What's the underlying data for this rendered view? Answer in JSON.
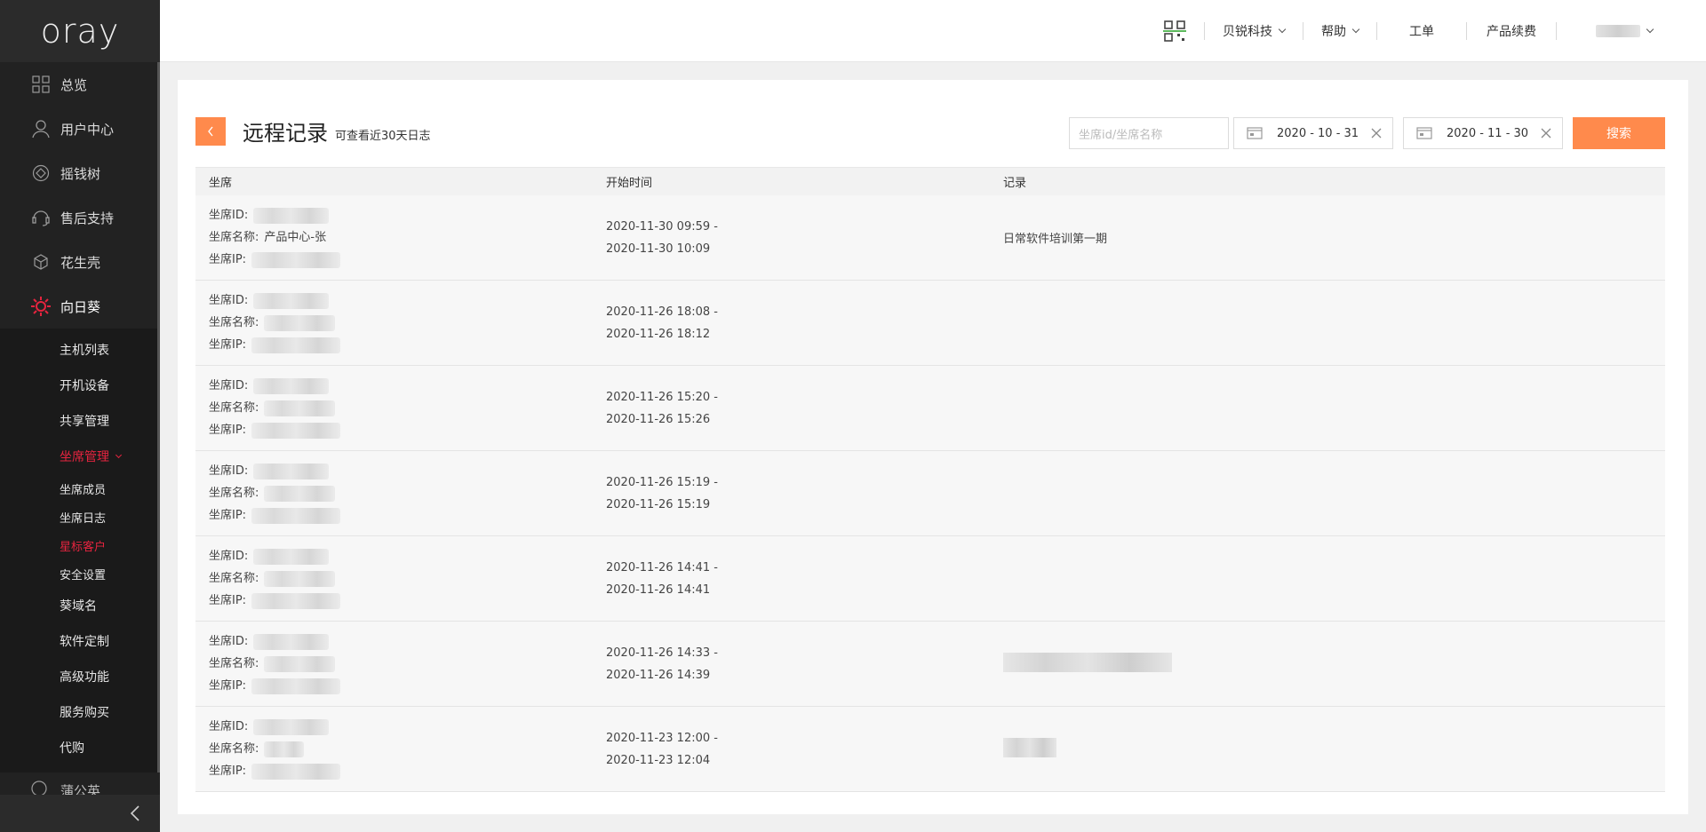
{
  "brand": {
    "logo": "oray"
  },
  "sidebar": {
    "items": [
      {
        "label": "总览",
        "icon": "grid-icon"
      },
      {
        "label": "用户中心",
        "icon": "user-icon"
      },
      {
        "label": "摇钱树",
        "icon": "diamond-icon"
      },
      {
        "label": "售后支持",
        "icon": "headset-icon"
      },
      {
        "label": "花生壳",
        "icon": "shell-icon"
      },
      {
        "label": "向日葵",
        "icon": "sunflower-icon"
      }
    ],
    "sub_items": [
      "主机列表",
      "开机设备",
      "共享管理",
      "坐席管理"
    ],
    "seat_sub_items": [
      "坐席成员",
      "坐席日志",
      "星标客户",
      "安全设置"
    ],
    "more_items": [
      "葵域名",
      "软件定制",
      "高级功能",
      "服务购买",
      "代购"
    ],
    "peek_item": "蒲公英",
    "active_color": "#e6243f"
  },
  "header": {
    "org": "贝锐科技",
    "help": "帮助",
    "ticket": "工单",
    "renew": "产品续费"
  },
  "page": {
    "title": "远程记录",
    "subtitle": "可查看近30天日志",
    "search_placeholder": "坐席id/坐席名称",
    "date_from": "2020 - 10 - 31",
    "date_to": "2020 - 11 - 30",
    "search_button": "搜索",
    "accent": "#ff8a4c"
  },
  "table": {
    "headers": [
      "坐席",
      "开始时间",
      "记录"
    ],
    "labels": {
      "id": "坐席ID:",
      "name": "坐席名称:",
      "ip": "坐席IP:"
    },
    "rows": [
      {
        "name": "产品中心-张",
        "start": "2020-11-30 09:59 -",
        "end": "2020-11-30 10:09",
        "record": "日常软件培训第一期"
      },
      {
        "name": "",
        "start": "2020-11-26 18:08 -",
        "end": "2020-11-26 18:12",
        "record": ""
      },
      {
        "name": "",
        "start": "2020-11-26 15:20 -",
        "end": "2020-11-26 15:26",
        "record": ""
      },
      {
        "name": "",
        "start": "2020-11-26 15:19 -",
        "end": "2020-11-26 15:19",
        "record": ""
      },
      {
        "name": "",
        "start": "2020-11-26 14:41 -",
        "end": "2020-11-26 14:41",
        "record": ""
      },
      {
        "name": "",
        "start": "2020-11-26 14:33 -",
        "end": "2020-11-26 14:39",
        "record": ""
      },
      {
        "name": "",
        "start": "2020-11-23 12:00 -",
        "end": "2020-11-23 12:04",
        "record": ""
      }
    ]
  }
}
